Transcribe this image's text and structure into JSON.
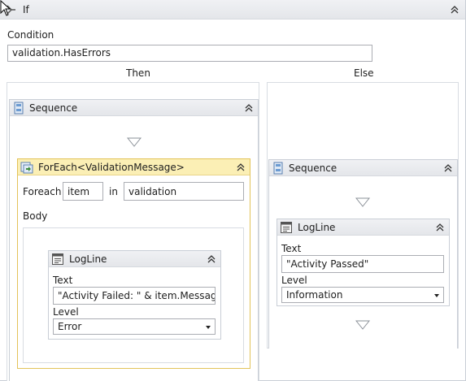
{
  "if_activity": {
    "title": "If",
    "condition_label": "Condition",
    "condition_value": "validation.HasErrors",
    "then_label": "Then",
    "else_label": "Else"
  },
  "then_sequence": {
    "title": "Sequence"
  },
  "foreach": {
    "title": "ForEach<ValidationMessage>",
    "foreach_label": "Foreach",
    "item_value": "item",
    "in_label": "in",
    "collection_value": "validation",
    "body_label": "Body"
  },
  "logline_failed": {
    "title": "LogLine",
    "text_label": "Text",
    "text_value": "\"Activity Failed: \" & item.Message",
    "level_label": "Level",
    "level_value": "Error"
  },
  "else_sequence": {
    "title": "Sequence"
  },
  "logline_passed": {
    "title": "LogLine",
    "text_label": "Text",
    "text_value": "\"Activity Passed\"",
    "level_label": "Level",
    "level_value": "Information"
  },
  "icons": {
    "if": "if-activity-icon",
    "sequence": "sequence-icon",
    "foreach": "foreach-icon",
    "logline": "logline-icon",
    "collapse": "collapse-chevron-icon",
    "drop": "drop-target-icon",
    "cursor": "mouse-cursor-icon"
  },
  "colors": {
    "foreach_header": "#fbefb5",
    "foreach_border": "#e3c35a",
    "header_gradient_top": "#f0f1f4",
    "border": "#c9ced6"
  }
}
